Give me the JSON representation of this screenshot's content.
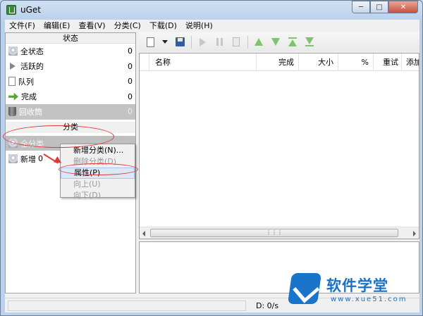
{
  "window": {
    "title": "uGet"
  },
  "menubar": [
    "文件(F)",
    "编辑(E)",
    "查看(V)",
    "分类(C)",
    "下载(D)",
    "说明(H)"
  ],
  "status_section": {
    "header": "状态",
    "items": [
      {
        "label": "全状态",
        "count": "0",
        "icon": "disk-icon"
      },
      {
        "label": "活跃的",
        "count": "0",
        "icon": "play-icon"
      },
      {
        "label": "队列",
        "count": "0",
        "icon": "page-icon"
      },
      {
        "label": "完成",
        "count": "0",
        "icon": "done-icon"
      },
      {
        "label": "回收筒",
        "count": "0",
        "icon": "trash-icon"
      }
    ]
  },
  "category_section": {
    "header": "分类",
    "items": [
      {
        "label": "全分类",
        "count": "0"
      },
      {
        "label": "新增",
        "count": "0"
      }
    ]
  },
  "context_menu": {
    "items": [
      {
        "label": "新增分类(N)...",
        "enabled": true
      },
      {
        "label": "删除分类(D)",
        "enabled": false
      },
      {
        "label": "属性(P)",
        "enabled": true
      },
      {
        "label": "向上(U)",
        "enabled": false
      },
      {
        "label": "向下(D)",
        "enabled": false
      }
    ]
  },
  "columns": [
    "名称",
    "完成",
    "大小",
    "%",
    "重试",
    "添加"
  ],
  "statusbar": {
    "speed": "D: 0/s"
  },
  "watermark": {
    "title": "软件学堂",
    "url": "www.xue51.com"
  },
  "colors": {
    "annotation": "#e0383a",
    "toolbar_arrows": "#7fc36f"
  }
}
